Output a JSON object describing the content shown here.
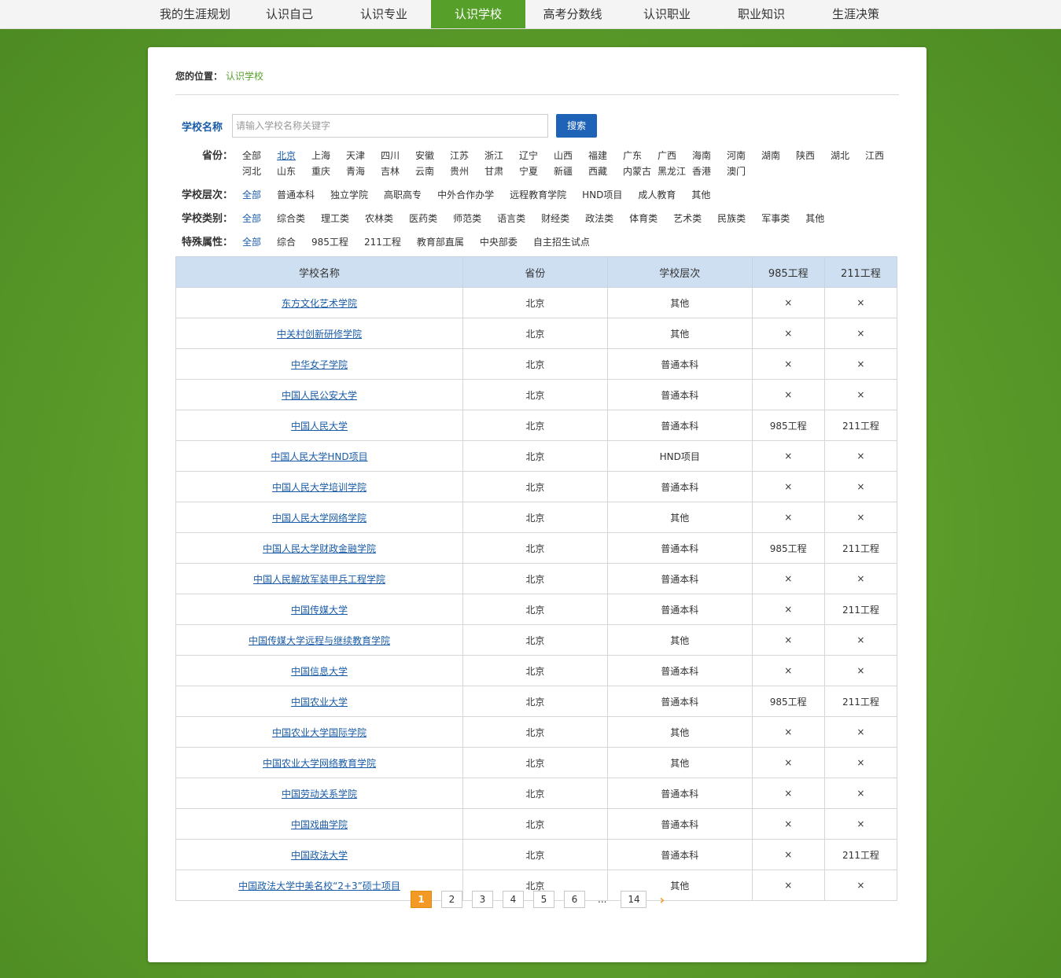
{
  "nav": {
    "items": [
      {
        "label": "我的生涯规划",
        "active": false
      },
      {
        "label": "认识自己",
        "active": false
      },
      {
        "label": "认识专业",
        "active": false
      },
      {
        "label": "认识学校",
        "active": true
      },
      {
        "label": "高考分数线",
        "active": false
      },
      {
        "label": "认识职业",
        "active": false
      },
      {
        "label": "职业知识",
        "active": false
      },
      {
        "label": "生涯决策",
        "active": false
      }
    ]
  },
  "breadcrumb": {
    "label": "您的位置：",
    "current": "认识学校"
  },
  "search": {
    "label": "学校名称",
    "placeholder": "请输入学校名称关键字",
    "value": "",
    "button": "搜索"
  },
  "filters": {
    "province": {
      "label": "省份：",
      "row1": [
        "全部",
        "北京",
        "上海",
        "天津",
        "四川",
        "安徽",
        "江苏",
        "浙江",
        "辽宁",
        "山西",
        "福建",
        "广东",
        "广西",
        "海南",
        "河南",
        "湖南",
        "陕西",
        "湖北",
        "江西"
      ],
      "row2": [
        "河北",
        "山东",
        "重庆",
        "青海",
        "吉林",
        "云南",
        "贵州",
        "甘肃",
        "宁夏",
        "新疆",
        "西藏",
        "内蒙古",
        "黑龙江",
        "香港",
        "澳门"
      ],
      "selected": "北京"
    },
    "level": {
      "label": "学校层次：",
      "options": [
        "全部",
        "普通本科",
        "独立学院",
        "高职高专",
        "中外合作办学",
        "远程教育学院",
        "HND项目",
        "成人教育",
        "其他"
      ],
      "selected": "全部"
    },
    "category": {
      "label": "学校类别：",
      "options": [
        "全部",
        "综合类",
        "理工类",
        "农林类",
        "医药类",
        "师范类",
        "语言类",
        "财经类",
        "政法类",
        "体育类",
        "艺术类",
        "民族类",
        "军事类",
        "其他"
      ],
      "selected": "全部"
    },
    "special": {
      "label": "特殊属性：",
      "options": [
        "全部",
        "综合",
        "985工程",
        "211工程",
        "教育部直属",
        "中央部委",
        "自主招生试点"
      ],
      "selected": "全部"
    }
  },
  "table": {
    "headers": [
      "学校名称",
      "省份",
      "学校层次",
      "985工程",
      "211工程"
    ],
    "rows": [
      [
        "东方文化艺术学院",
        "北京",
        "其他",
        "×",
        "×"
      ],
      [
        "中关村创新研修学院",
        "北京",
        "其他",
        "×",
        "×"
      ],
      [
        "中华女子学院",
        "北京",
        "普通本科",
        "×",
        "×"
      ],
      [
        "中国人民公安大学",
        "北京",
        "普通本科",
        "×",
        "×"
      ],
      [
        "中国人民大学",
        "北京",
        "普通本科",
        "985工程",
        "211工程"
      ],
      [
        "中国人民大学HND项目",
        "北京",
        "HND项目",
        "×",
        "×"
      ],
      [
        "中国人民大学培训学院",
        "北京",
        "普通本科",
        "×",
        "×"
      ],
      [
        "中国人民大学网络学院",
        "北京",
        "其他",
        "×",
        "×"
      ],
      [
        "中国人民大学财政金融学院",
        "北京",
        "普通本科",
        "985工程",
        "211工程"
      ],
      [
        "中国人民解放军装甲兵工程学院",
        "北京",
        "普通本科",
        "×",
        "×"
      ],
      [
        "中国传媒大学",
        "北京",
        "普通本科",
        "×",
        "211工程"
      ],
      [
        "中国传媒大学远程与继续教育学院",
        "北京",
        "其他",
        "×",
        "×"
      ],
      [
        "中国信息大学",
        "北京",
        "普通本科",
        "×",
        "×"
      ],
      [
        "中国农业大学",
        "北京",
        "普通本科",
        "985工程",
        "211工程"
      ],
      [
        "中国农业大学国际学院",
        "北京",
        "其他",
        "×",
        "×"
      ],
      [
        "中国农业大学网络教育学院",
        "北京",
        "其他",
        "×",
        "×"
      ],
      [
        "中国劳动关系学院",
        "北京",
        "普通本科",
        "×",
        "×"
      ],
      [
        "中国戏曲学院",
        "北京",
        "普通本科",
        "×",
        "×"
      ],
      [
        "中国政法大学",
        "北京",
        "普通本科",
        "×",
        "211工程"
      ],
      [
        "中国政法大学中美名校“2+3”硕士项目",
        "北京",
        "其他",
        "×",
        "×"
      ]
    ]
  },
  "pager": {
    "pages": [
      "1",
      "2",
      "3",
      "4",
      "5",
      "6"
    ],
    "current": "1",
    "ellipsis": "...",
    "last": "14",
    "next": "›"
  }
}
